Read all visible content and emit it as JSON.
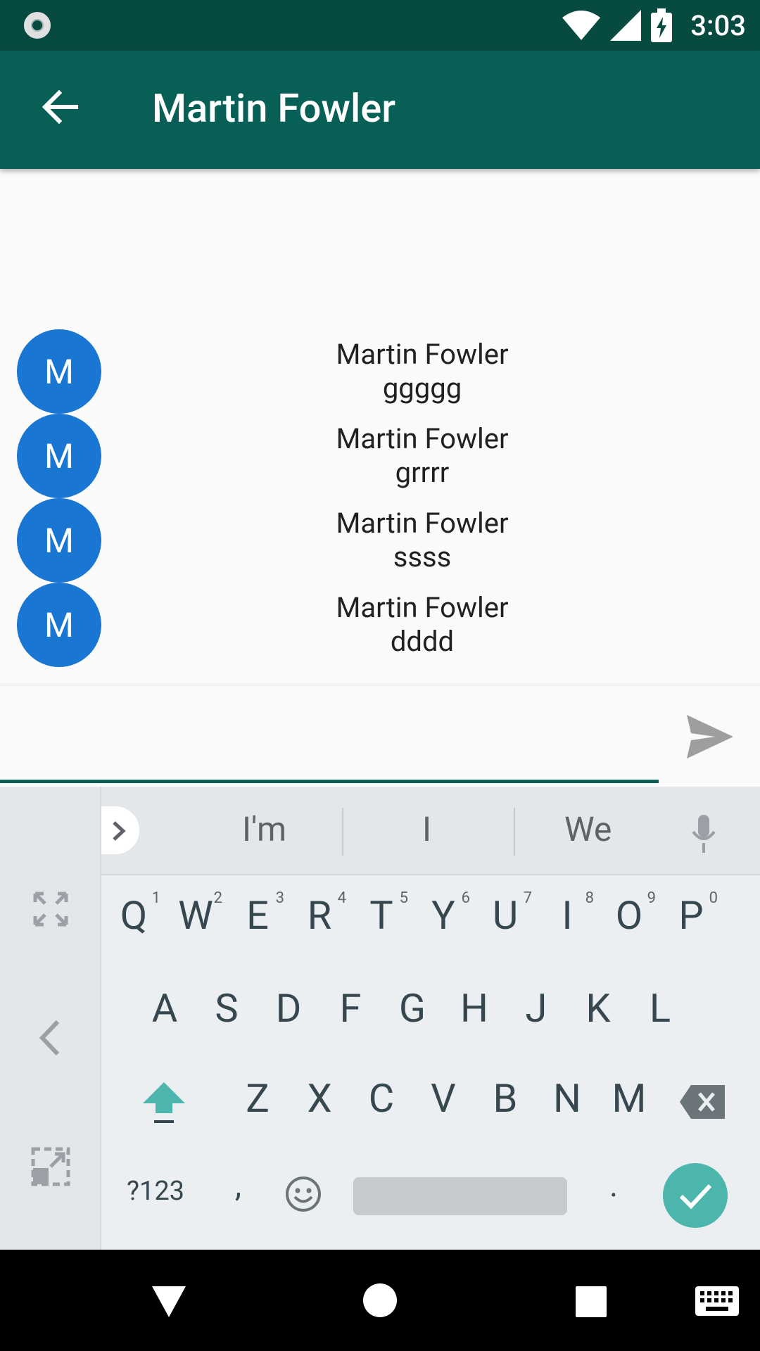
{
  "status_bar": {
    "time": "3:03"
  },
  "app_bar": {
    "title": "Martin Fowler"
  },
  "messages": [
    {
      "avatar": "M",
      "author": "Martin Fowler",
      "text": "ggggg"
    },
    {
      "avatar": "M",
      "author": "Martin Fowler",
      "text": "grrrr"
    },
    {
      "avatar": "M",
      "author": "Martin Fowler",
      "text": "ssss"
    },
    {
      "avatar": "M",
      "author": "Martin Fowler",
      "text": "dddd"
    }
  ],
  "composer": {
    "value": ""
  },
  "keyboard": {
    "suggestions": [
      "I'm",
      "I",
      "We"
    ],
    "row1": [
      "Q",
      "W",
      "E",
      "R",
      "T",
      "Y",
      "U",
      "I",
      "O",
      "P"
    ],
    "row1_hints": [
      "1",
      "2",
      "3",
      "4",
      "5",
      "6",
      "7",
      "8",
      "9",
      "0"
    ],
    "row2": [
      "A",
      "S",
      "D",
      "F",
      "G",
      "H",
      "J",
      "K",
      "L"
    ],
    "row3": [
      "Z",
      "X",
      "C",
      "V",
      "B",
      "N",
      "M"
    ],
    "symbols_label": "?123",
    "comma": ",",
    "period": ".",
    "colors": {
      "accent": "#4db6ac",
      "primary": "#085f55",
      "avatar": "#1976d2"
    }
  }
}
